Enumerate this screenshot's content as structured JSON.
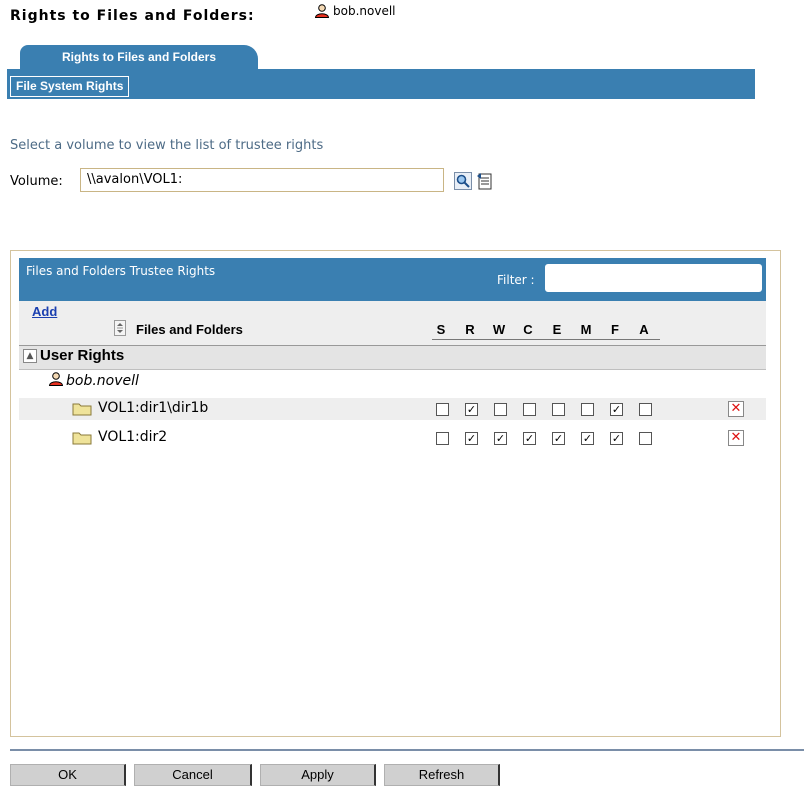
{
  "header": {
    "title": "Rights to Files and Folders:",
    "user": "bob.novell"
  },
  "tabs": {
    "main": "Rights to Files and Folders",
    "sub": "File System Rights"
  },
  "volume": {
    "instruction": "Select a volume to view the list of trustee rights",
    "label": "Volume:",
    "value": "\\\\avalon\\VOL1:"
  },
  "icons": {
    "search": "search-icon",
    "browse": "browse-icon",
    "user": "user-icon",
    "folder": "folder-icon",
    "delete": "delete-icon"
  },
  "panel": {
    "title": "Files and Folders Trustee Rights",
    "filter_label": "Filter :",
    "filter_value": "",
    "add_label": "Add",
    "column_files": "Files and Folders",
    "rights_headers": [
      "S",
      "R",
      "W",
      "C",
      "E",
      "M",
      "F",
      "A"
    ],
    "group_label": "User Rights",
    "trustee": "bob.novell",
    "rows": [
      {
        "name": "VOL1:dir1\\dir1b",
        "rights": [
          false,
          true,
          false,
          false,
          false,
          false,
          true,
          false
        ]
      },
      {
        "name": "VOL1:dir2",
        "rights": [
          false,
          true,
          true,
          true,
          true,
          true,
          true,
          false
        ]
      }
    ]
  },
  "buttons": {
    "ok": "OK",
    "cancel": "Cancel",
    "apply": "Apply",
    "refresh": "Refresh"
  },
  "colors": {
    "accent": "#3a7fb1",
    "link": "#1a3fb0",
    "delete": "#dd1111"
  }
}
